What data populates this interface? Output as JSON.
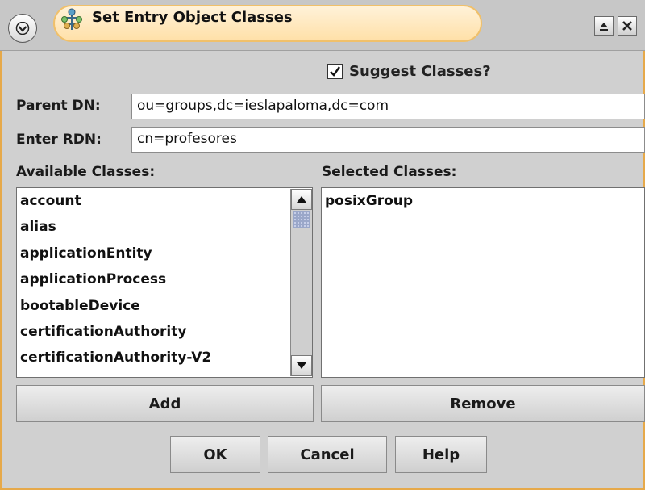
{
  "window": {
    "title": "Set Entry Object Classes",
    "accent_color": "#e6a94a"
  },
  "title_icons": {
    "menu": "chevron-down-icon",
    "app": "ldap-tree-icon",
    "maximize": "maximize-icon",
    "close": "close-icon"
  },
  "suggest": {
    "label": "Suggest Classes?",
    "checked": true
  },
  "parent_dn": {
    "label": "Parent DN:",
    "value": "ou=groups,dc=ieslapaloma,dc=com"
  },
  "rdn": {
    "label": "Enter RDN:",
    "value": "cn=profesores"
  },
  "available": {
    "heading": "Available Classes:",
    "items": [
      "account",
      "alias",
      "applicationEntity",
      "applicationProcess",
      "bootableDevice",
      "certificationAuthority",
      "certificationAuthority-V2"
    ]
  },
  "selected": {
    "heading": "Selected Classes:",
    "items": [
      "posixGroup"
    ]
  },
  "buttons": {
    "add": "Add",
    "remove": "Remove",
    "ok": "OK",
    "cancel": "Cancel",
    "help": "Help"
  }
}
